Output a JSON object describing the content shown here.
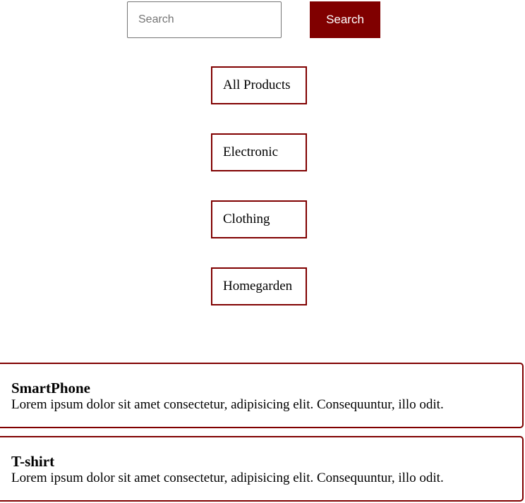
{
  "search": {
    "placeholder": "Search",
    "value": "",
    "button_label": "Search"
  },
  "filters": [
    {
      "label": "All Products"
    },
    {
      "label": "Electronic"
    },
    {
      "label": "Clothing"
    },
    {
      "label": "Homegarden"
    }
  ],
  "products": [
    {
      "name": "SmartPhone",
      "description": "Lorem ipsum dolor sit amet consectetur, adipisicing elit. Consequuntur, illo odit."
    },
    {
      "name": "T-shirt",
      "description": "Lorem ipsum dolor sit amet consectetur, adipisicing elit. Consequuntur, illo odit."
    }
  ],
  "colors": {
    "accent": "#800000",
    "button_text": "#ffffff",
    "background": "#ffffff",
    "text": "#000000"
  }
}
